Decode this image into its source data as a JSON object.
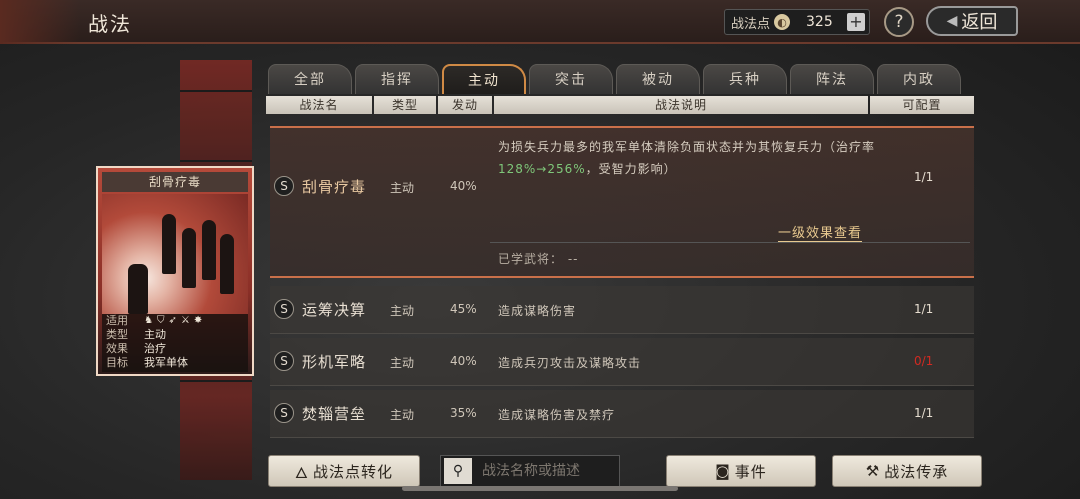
{
  "header": {
    "title": "战法",
    "points_label": "战法点",
    "points_value": "325",
    "plus_label": "+",
    "help_label": "?",
    "back_label": "返回"
  },
  "card": {
    "title": "刮骨疗毒",
    "info": [
      {
        "k": "适用",
        "v": ""
      },
      {
        "k": "类型",
        "v": "主动"
      },
      {
        "k": "效果",
        "v": "治疗"
      },
      {
        "k": "目标",
        "v": "我军单体"
      }
    ]
  },
  "tabs": [
    "全部",
    "指挥",
    "主动",
    "突击",
    "被动",
    "兵种",
    "阵法",
    "内政"
  ],
  "active_tab": 2,
  "columns": [
    "战法名",
    "类型",
    "发动",
    "战法说明",
    "可配置"
  ],
  "selected_row": {
    "badge": "S",
    "name": "刮骨疗毒",
    "type": "主动",
    "rate": "40%",
    "desc_part1": "为损失兵力最多的我军单体清除负面状态并为其恢复兵力（治疗率",
    "desc_green": "128%→256%",
    "desc_part2": "，受智力影响）",
    "count": "1/1",
    "effect_link": "一级效果查看",
    "learned_label": "已学武将：",
    "learned_value": "--"
  },
  "rows": [
    {
      "badge": "S",
      "name": "运筹决算",
      "type": "主动",
      "rate": "45%",
      "desc": "造成谋略伤害",
      "count": "1/1",
      "red": false
    },
    {
      "badge": "S",
      "name": "形机军略",
      "type": "主动",
      "rate": "40%",
      "desc": "造成兵刃攻击及谋略攻击",
      "count": "0/1",
      "red": true
    },
    {
      "badge": "S",
      "name": "焚辎营垒",
      "type": "主动",
      "rate": "35%",
      "desc": "造成谋略伤害及禁疗",
      "count": "1/1",
      "red": false
    }
  ],
  "bottom": {
    "convert_label": "战法点转化",
    "search_placeholder": "战法名称或描述",
    "event_label": "事件",
    "inherit_label": "战法传承"
  },
  "colors": {
    "accent": "#d08a45",
    "selected_border": "#c9704a",
    "heal_green": "#7fc77a",
    "warning_red": "#d12a22"
  }
}
